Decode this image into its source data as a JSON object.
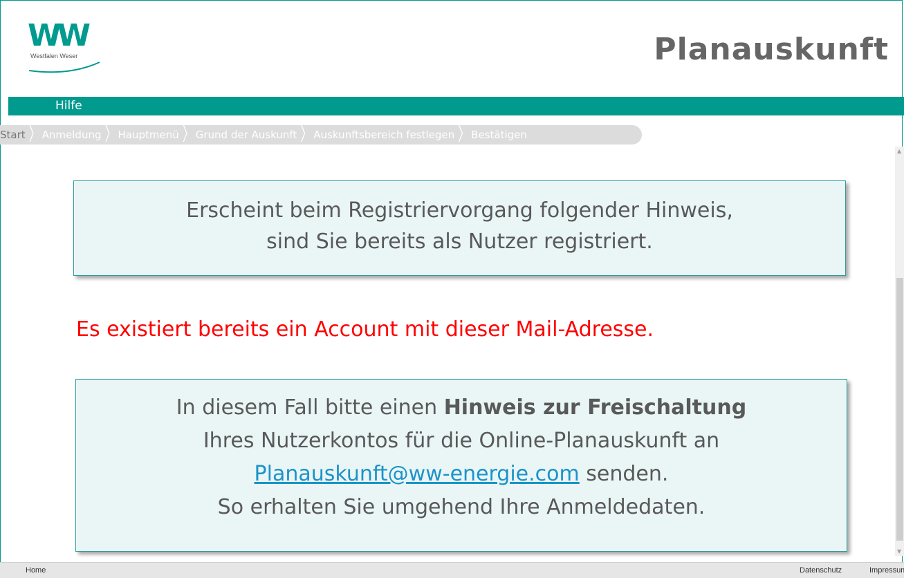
{
  "header": {
    "logo_text": "WW",
    "logo_subtext": "Westfalen Weser",
    "title": "Planauskunft"
  },
  "menu": {
    "items": [
      {
        "label": "Hilfe"
      }
    ]
  },
  "breadcrumb": {
    "items": [
      {
        "label": "Start"
      },
      {
        "label": "Anmeldung"
      },
      {
        "label": "Hauptmenü"
      },
      {
        "label": "Grund der Auskunft"
      },
      {
        "label": "Auskunftsbereich festlegen"
      },
      {
        "label": "Bestätigen"
      }
    ]
  },
  "info_box_1": {
    "line1": "Erscheint beim Registriervorgang folgender Hinweis,",
    "line2": "sind Sie bereits als Nutzer registriert."
  },
  "error_message": "Es existiert bereits ein Account mit dieser Mail-Adresse.",
  "info_box_2": {
    "line1_prefix": "In diesem Fall bitte einen ",
    "line1_bold": "Hinweis zur Freischaltung",
    "line2": "Ihres Nutzerkontos für die Online-Planauskunft an",
    "email": "Planauskunft@ww-energie.com",
    "line3_suffix": " senden.",
    "line4": "So erhalten Sie umgehend Ihre Anmeldedaten."
  },
  "footer": {
    "home": "Home",
    "privacy": "Datenschutz",
    "imprint": "Impressum"
  },
  "colors": {
    "brand_teal": "#009a8e",
    "error_red": "#ff0000",
    "link_blue": "#1b93c9",
    "box_fill": "#eaf6f6"
  }
}
